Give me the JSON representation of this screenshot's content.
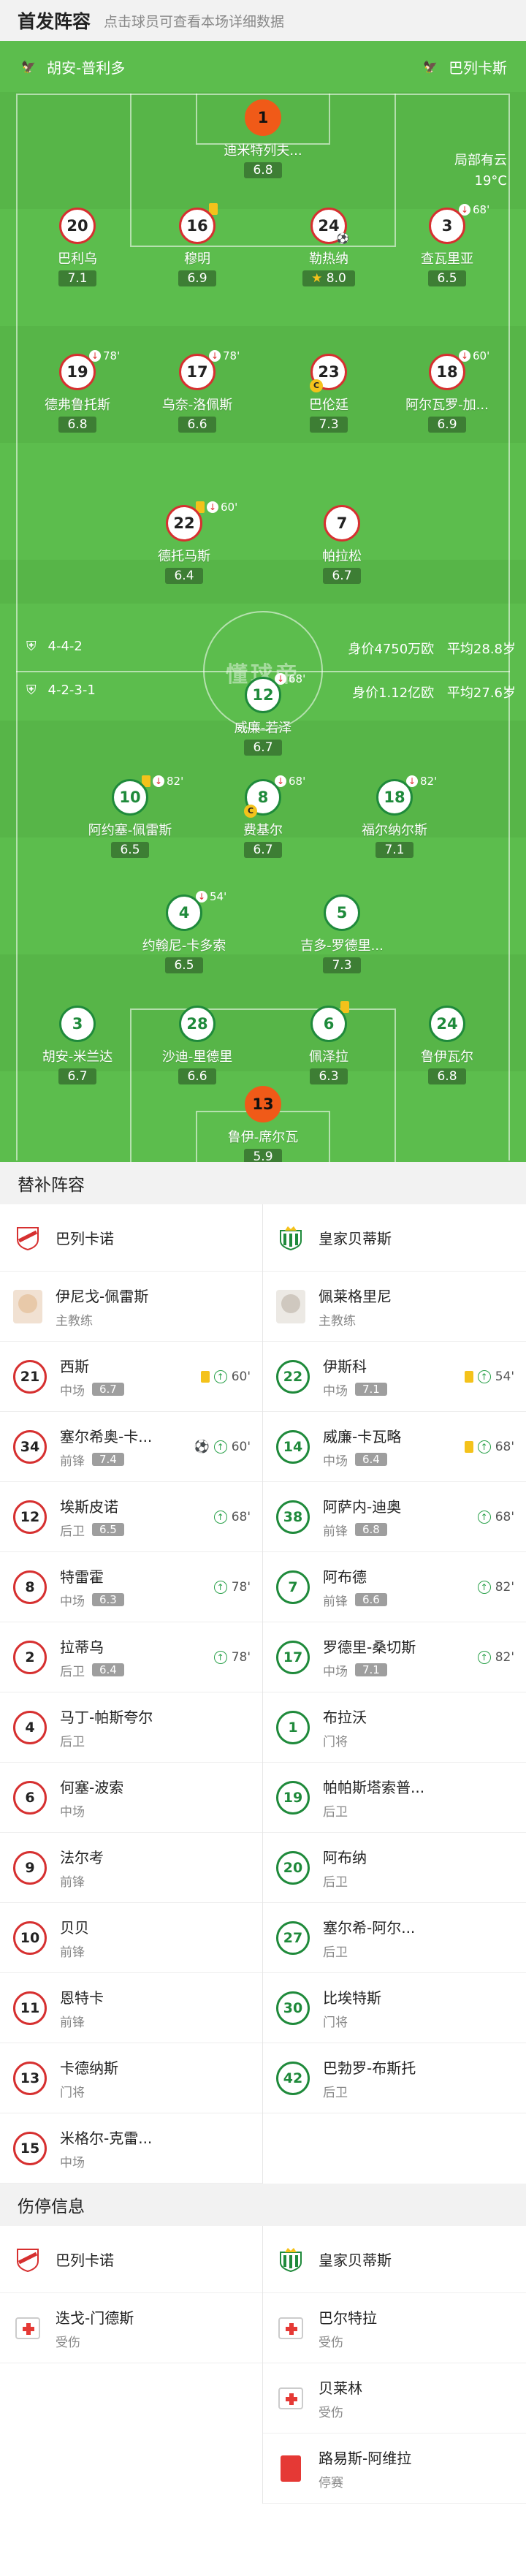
{
  "header": {
    "title": "首发阵容",
    "subtitle": "点击球员可查看本场详细数据"
  },
  "pitch": {
    "home_team": "胡安-普利多",
    "away_team": "巴列卡斯",
    "weather": "局部有云",
    "temperature": "19°C",
    "watermark": "懂球帝",
    "home_formation": "4-4-2",
    "home_value": "身价4750万欧",
    "home_age": "平均28.8岁",
    "away_formation": "4-2-3-1",
    "away_value": "身价1.12亿欧",
    "away_age": "平均27.6岁"
  },
  "rayo_players": [
    {
      "num": "1",
      "name": "迪米特列夫...",
      "rating": "6.8",
      "gk": true
    },
    {
      "num": "20",
      "name": "巴利乌",
      "rating": "7.1"
    },
    {
      "num": "16",
      "name": "穆明",
      "rating": "6.9",
      "yellow": true
    },
    {
      "num": "24",
      "name": "勒热纳",
      "rating": "8.0",
      "star": true,
      "goal": true
    },
    {
      "num": "3",
      "name": "查瓦里亚",
      "rating": "6.5",
      "sub": "68'"
    },
    {
      "num": "19",
      "name": "德弗鲁托斯",
      "rating": "6.8",
      "sub": "78'"
    },
    {
      "num": "17",
      "name": "乌奈-洛佩斯",
      "rating": "6.6",
      "sub": "78'"
    },
    {
      "num": "23",
      "name": "巴伦廷",
      "rating": "7.3",
      "captain": true
    },
    {
      "num": "18",
      "name": "阿尔瓦罗-加...",
      "rating": "6.9",
      "sub": "60'"
    },
    {
      "num": "22",
      "name": "德托马斯",
      "rating": "6.4",
      "yellow": true,
      "sub": "60'"
    },
    {
      "num": "7",
      "name": "帕拉松",
      "rating": "6.7"
    }
  ],
  "betis_players": [
    {
      "num": "12",
      "name": "威廉-若泽",
      "rating": "6.7",
      "sub": "68'"
    },
    {
      "num": "10",
      "name": "阿约塞-佩雷斯",
      "rating": "6.5",
      "yellow": true,
      "sub": "82'"
    },
    {
      "num": "8",
      "name": "费基尔",
      "rating": "6.7",
      "captain": true,
      "sub": "68'"
    },
    {
      "num": "18",
      "name": "福尔纳尔斯",
      "rating": "7.1",
      "sub": "82'"
    },
    {
      "num": "4",
      "name": "约翰尼-卡多索",
      "rating": "6.5",
      "sub": "54'"
    },
    {
      "num": "5",
      "name": "吉多-罗德里...",
      "rating": "7.3"
    },
    {
      "num": "3",
      "name": "胡安-米兰达",
      "rating": "6.7"
    },
    {
      "num": "28",
      "name": "沙迪-里德里",
      "rating": "6.6"
    },
    {
      "num": "6",
      "name": "佩泽拉",
      "rating": "6.3",
      "yellow": true
    },
    {
      "num": "24",
      "name": "鲁伊瓦尔",
      "rating": "6.8"
    },
    {
      "num": "13",
      "name": "鲁伊-席尔瓦",
      "rating": "5.9",
      "gk": true
    }
  ],
  "subs": {
    "title": "替补阵容",
    "home_team": "巴列卡诺",
    "away_team": "皇家贝蒂斯",
    "home_coach": {
      "name": "伊尼戈-佩雷斯",
      "role": "主教练"
    },
    "away_coach": {
      "name": "佩莱格里尼",
      "role": "主教练"
    },
    "home": [
      {
        "num": "21",
        "name": "西斯",
        "pos": "中场",
        "rating": "6.7",
        "yellow": true,
        "time": "60'"
      },
      {
        "num": "34",
        "name": "塞尔希奥-卡...",
        "pos": "前锋",
        "rating": "7.4",
        "goal": true,
        "time": "60'"
      },
      {
        "num": "12",
        "name": "埃斯皮诺",
        "pos": "后卫",
        "rating": "6.5",
        "time": "68'"
      },
      {
        "num": "8",
        "name": "特雷霍",
        "pos": "中场",
        "rating": "6.3",
        "time": "78'"
      },
      {
        "num": "2",
        "name": "拉蒂乌",
        "pos": "后卫",
        "rating": "6.4",
        "time": "78'"
      },
      {
        "num": "4",
        "name": "马丁-帕斯夸尔",
        "pos": "后卫"
      },
      {
        "num": "6",
        "name": "何塞-波索",
        "pos": "中场"
      },
      {
        "num": "9",
        "name": "法尔考",
        "pos": "前锋"
      },
      {
        "num": "10",
        "name": "贝贝",
        "pos": "前锋"
      },
      {
        "num": "11",
        "name": "恩特卡",
        "pos": "前锋"
      },
      {
        "num": "13",
        "name": "卡德纳斯",
        "pos": "门将"
      },
      {
        "num": "15",
        "name": "米格尔-克雷...",
        "pos": "中场"
      }
    ],
    "away": [
      {
        "num": "22",
        "name": "伊斯科",
        "pos": "中场",
        "rating": "7.1",
        "yellow": true,
        "time": "54'"
      },
      {
        "num": "14",
        "name": "威廉-卡瓦略",
        "pos": "中场",
        "rating": "6.4",
        "yellow": true,
        "time": "68'"
      },
      {
        "num": "38",
        "name": "阿萨内-迪奥",
        "pos": "前锋",
        "rating": "6.8",
        "time": "68'"
      },
      {
        "num": "7",
        "name": "阿布德",
        "pos": "前锋",
        "rating": "6.6",
        "time": "82'"
      },
      {
        "num": "17",
        "name": "罗德里-桑切斯",
        "pos": "中场",
        "rating": "7.1",
        "time": "82'"
      },
      {
        "num": "1",
        "name": "布拉沃",
        "pos": "门将"
      },
      {
        "num": "19",
        "name": "帕帕斯塔索普...",
        "pos": "后卫"
      },
      {
        "num": "20",
        "name": "阿布纳",
        "pos": "后卫"
      },
      {
        "num": "27",
        "name": "塞尔希-阿尔...",
        "pos": "后卫"
      },
      {
        "num": "30",
        "name": "比埃特斯",
        "pos": "门将"
      },
      {
        "num": "42",
        "name": "巴勃罗-布斯托",
        "pos": "后卫"
      }
    ]
  },
  "injuries": {
    "title": "伤停信息",
    "home_team": "巴列卡诺",
    "away_team": "皇家贝蒂斯",
    "home": [
      {
        "name": "迭戈-门德斯",
        "status": "受伤"
      }
    ],
    "away": [
      {
        "name": "巴尔特拉",
        "status": "受伤"
      },
      {
        "name": "贝莱林",
        "status": "受伤"
      },
      {
        "name": "路易斯-阿维拉",
        "status": "停赛",
        "red": true
      }
    ]
  },
  "colors": {
    "pitch": "#5cbd4d",
    "rayo": "#d63030",
    "betis": "#1f8a3b",
    "gk": "#f05a18",
    "yellow": "#f4c21b",
    "red": "#e53935"
  }
}
